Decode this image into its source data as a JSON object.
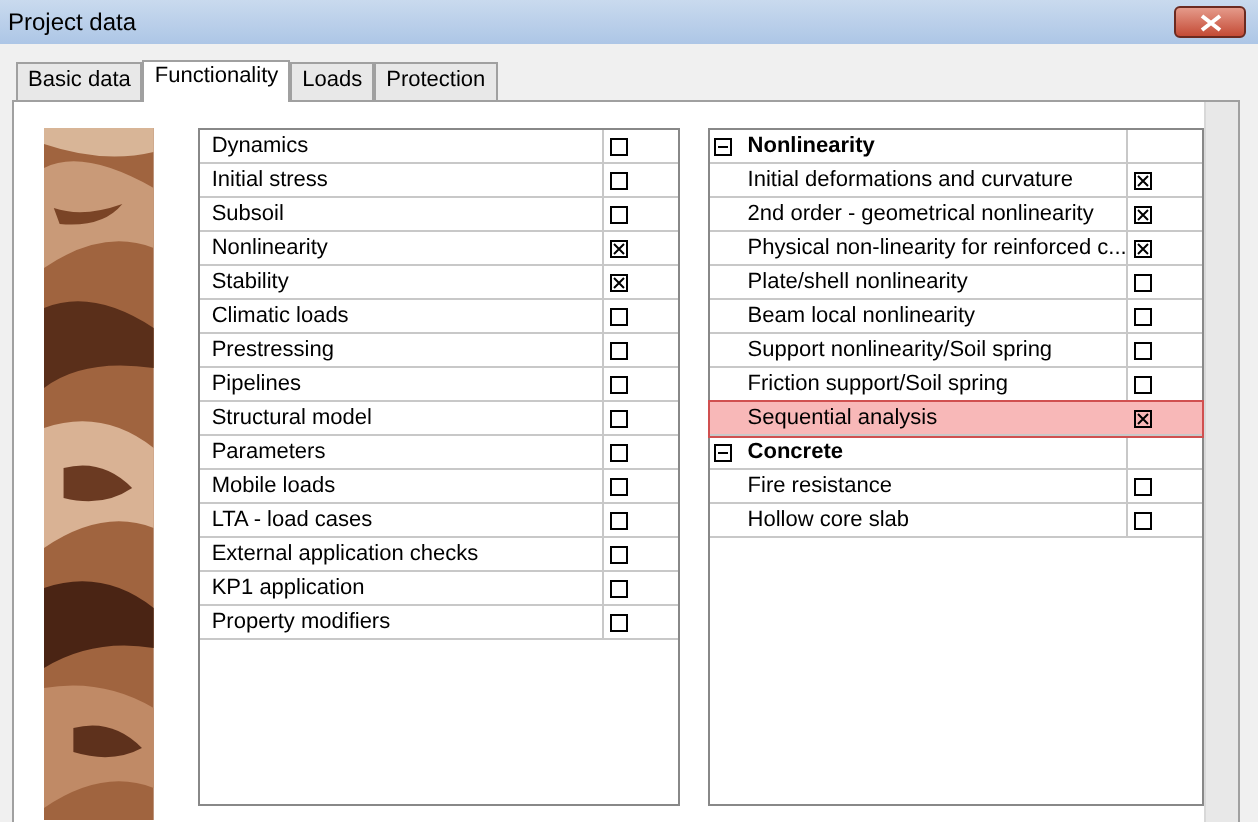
{
  "window": {
    "title": "Project data"
  },
  "tabs": [
    {
      "label": "Basic data",
      "selected": false
    },
    {
      "label": "Functionality",
      "selected": true
    },
    {
      "label": "Loads",
      "selected": false
    },
    {
      "label": "Protection",
      "selected": false
    }
  ],
  "features": [
    {
      "label": "Dynamics",
      "checked": false
    },
    {
      "label": "Initial stress",
      "checked": false
    },
    {
      "label": "Subsoil",
      "checked": false
    },
    {
      "label": "Nonlinearity",
      "checked": true
    },
    {
      "label": "Stability",
      "checked": true
    },
    {
      "label": "Climatic loads",
      "checked": false
    },
    {
      "label": "Prestressing",
      "checked": false
    },
    {
      "label": "Pipelines",
      "checked": false
    },
    {
      "label": "Structural model",
      "checked": false
    },
    {
      "label": "Parameters",
      "checked": false
    },
    {
      "label": "Mobile loads",
      "checked": false
    },
    {
      "label": "LTA - load cases",
      "checked": false
    },
    {
      "label": "External application checks",
      "checked": false
    },
    {
      "label": "KP1 application",
      "checked": false
    },
    {
      "label": "Property modifiers",
      "checked": false
    }
  ],
  "groups": [
    {
      "label": "Nonlinearity",
      "expanded": true,
      "children": [
        {
          "label": "Initial deformations and curvature",
          "checked": true,
          "selected": false
        },
        {
          "label": "2nd order - geometrical nonlinearity",
          "checked": true,
          "selected": false
        },
        {
          "label": "Physical non-linearity for reinforced c...",
          "checked": true,
          "selected": false
        },
        {
          "label": "Plate/shell nonlinearity",
          "checked": false,
          "selected": false
        },
        {
          "label": "Beam local nonlinearity",
          "checked": false,
          "selected": false
        },
        {
          "label": "Support nonlinearity/Soil spring",
          "checked": false,
          "selected": false
        },
        {
          "label": "Friction support/Soil spring",
          "checked": false,
          "selected": false
        },
        {
          "label": "Sequential analysis",
          "checked": true,
          "selected": true
        }
      ]
    },
    {
      "label": "Concrete",
      "expanded": true,
      "children": [
        {
          "label": "Fire resistance",
          "checked": false,
          "selected": false
        },
        {
          "label": "Hollow core slab",
          "checked": false,
          "selected": false
        }
      ]
    }
  ]
}
